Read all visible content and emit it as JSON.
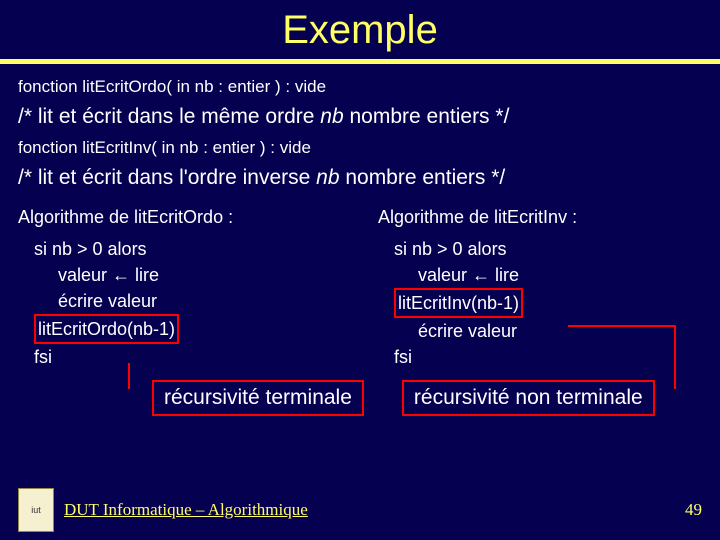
{
  "title": "Exemple",
  "fn1_sig": "fonction litEcritOrdo( in nb : entier ) : vide",
  "desc1_pre": "/* ",
  "desc1_text": "lit et écrit dans le même ordre ",
  "desc1_nb": "nb",
  "desc1_post": " nombre entiers ",
  "desc1_end": "*/",
  "fn2_sig": "fonction litEcritInv( in nb : entier ) : vide",
  "desc2_pre": "/* ",
  "desc2_text": "lit et écrit dans l'ordre inverse ",
  "desc2_nb": "nb",
  "desc2_post": " nombre entiers ",
  "desc2_end": "*/",
  "left": {
    "head": "Algorithme de litEcritOrdo :",
    "l1": "si nb > 0 alors",
    "l2": "valeur ← lire",
    "l3": "écrire valeur",
    "l4": "litEcritOrdo(nb-1)",
    "l5": "fsi",
    "label": "récursivité terminale"
  },
  "right": {
    "head": "Algorithme de litEcritInv :",
    "l1": "si nb > 0 alors",
    "l2": "valeur ← lire",
    "l3": "litEcritInv(nb-1)",
    "l4": "écrire valeur",
    "l5": "fsi",
    "label": "récursivité non terminale"
  },
  "footer": "DUT Informatique – Algorithmique",
  "page": "49"
}
